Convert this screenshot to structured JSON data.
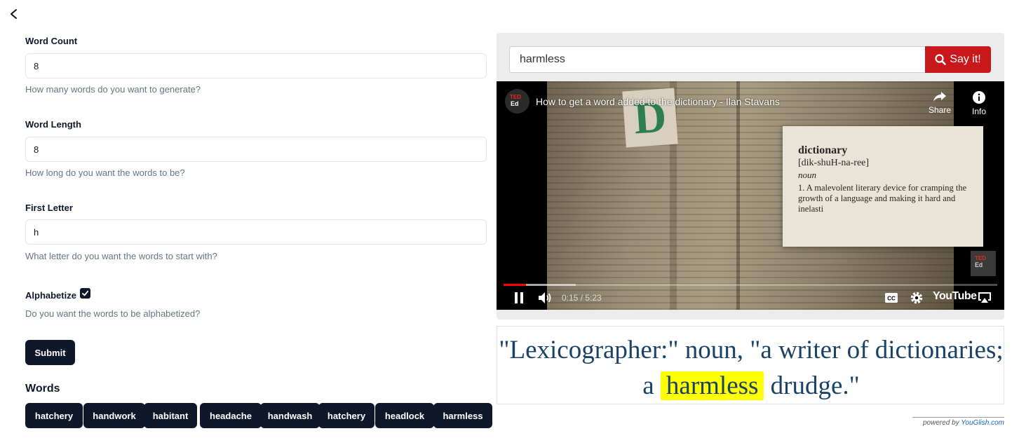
{
  "form": {
    "word_count": {
      "label": "Word Count",
      "value": "8",
      "help": "How many words do you want to generate?"
    },
    "word_length": {
      "label": "Word Length",
      "value": "8",
      "help": "How long do you want the words to be?"
    },
    "first_letter": {
      "label": "First Letter",
      "value": "h",
      "help": "What letter do you want the words to start with?"
    },
    "alphabetize": {
      "label": "Alphabetize",
      "checked": true,
      "help": "Do you want the words to be alphabetized?"
    },
    "submit_label": "Submit"
  },
  "words": {
    "title": "Words",
    "items": [
      "hatchery",
      "handwork",
      "habitant",
      "headache",
      "handwash",
      "hatchery",
      "headlock",
      "harmless"
    ]
  },
  "youglish": {
    "search_value": "harmless",
    "say_label": "Say it!",
    "video": {
      "channel_badge_top": "TED",
      "channel_badge_bottom": "Ed",
      "title": "How to get a word added to the dictionary - Ilan Stavans",
      "share_label": "Share",
      "info_label": "Info",
      "frame": {
        "big_letter": "D",
        "def_word": "dictionary",
        "def_pron": "[dik-shuH-na-ree]",
        "def_pos": "noun",
        "def_text": "1. A malevolent literary device for cramping the growth of a language and making it hard and inelasti"
      },
      "time": "0:15 / 5:23",
      "progress_fraction": 0.046,
      "buffer_fraction": 0.146,
      "brand": "YouTube"
    },
    "quote": {
      "before": "\"Lexicographer:\" noun, \"a writer of dictionaries; a",
      "highlight": "harmless",
      "after": "drudge.\""
    },
    "powered_prefix": "powered by ",
    "powered_brand": "YouGlish.com"
  },
  "colors": {
    "primary": "#0f172a",
    "say_button": "#c9181c",
    "highlight": "#ffff00",
    "quote_text": "#1a4266",
    "progress": "#ff0000"
  },
  "icons": [
    "back-arrow-icon",
    "check-icon",
    "search-icon",
    "share-icon",
    "info-icon",
    "pause-icon",
    "volume-icon",
    "captions-icon",
    "settings-icon",
    "airplay-icon"
  ]
}
